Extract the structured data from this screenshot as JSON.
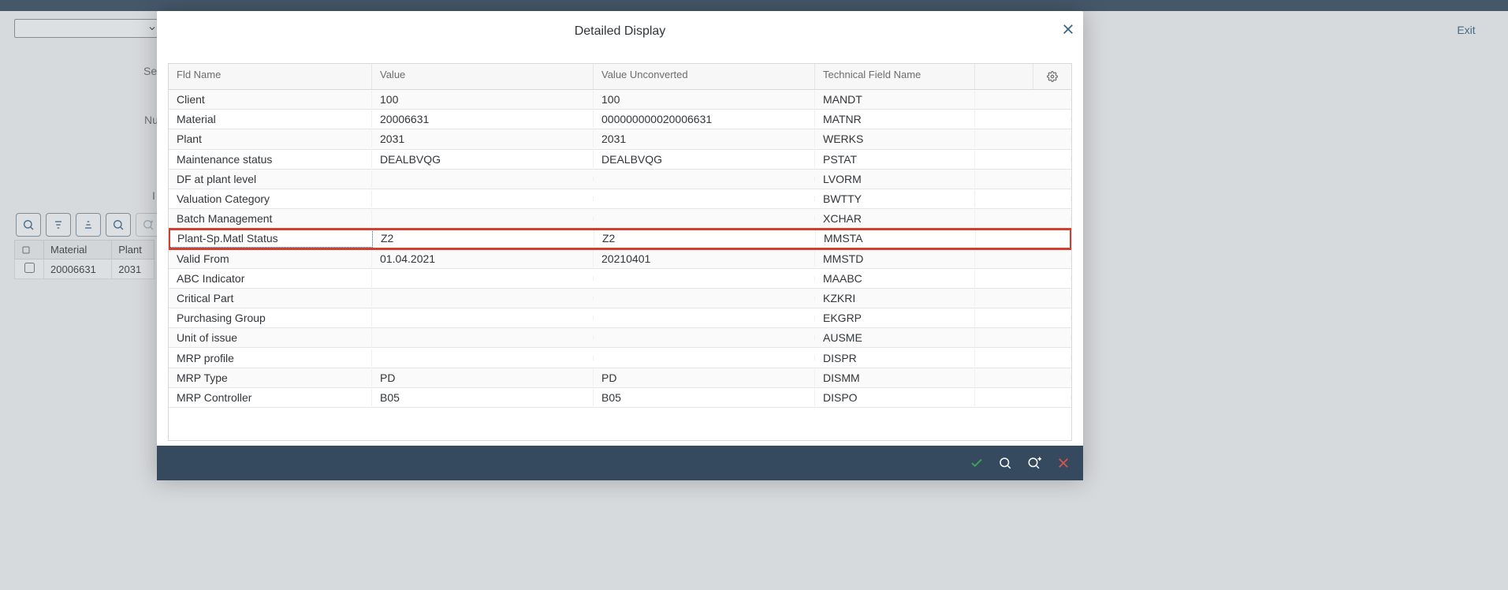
{
  "bg": {
    "exit_label": "Exit",
    "labels": {
      "se": "Se",
      "nu": "Nu",
      "i": "I"
    },
    "grid": {
      "columns": [
        "",
        "Material",
        "Plant"
      ],
      "row": {
        "material": "20006631",
        "plant": "2031"
      }
    }
  },
  "dialog": {
    "title": "Detailed Display",
    "columns": [
      "Fld Name",
      "Value",
      "Value Unconverted",
      "Technical Field Name"
    ],
    "rows": [
      {
        "fld": "Client",
        "val": "100",
        "uval": "100",
        "tech": "MANDT"
      },
      {
        "fld": "Material",
        "val": "20006631",
        "uval": "000000000020006631",
        "tech": "MATNR"
      },
      {
        "fld": "Plant",
        "val": "2031",
        "uval": "2031",
        "tech": "WERKS"
      },
      {
        "fld": "Maintenance status",
        "val": "DEALBVQG",
        "uval": "DEALBVQG",
        "tech": "PSTAT"
      },
      {
        "fld": "DF at plant level",
        "val": "",
        "uval": "",
        "tech": "LVORM"
      },
      {
        "fld": "Valuation Category",
        "val": "",
        "uval": "",
        "tech": "BWTTY"
      },
      {
        "fld": "Batch Management",
        "val": "",
        "uval": "",
        "tech": "XCHAR"
      },
      {
        "fld": "Plant-Sp.Matl Status",
        "val": "Z2",
        "uval": "Z2",
        "tech": "MMSTA",
        "highlight": true
      },
      {
        "fld": "Valid From",
        "val": "01.04.2021",
        "uval": "20210401",
        "tech": "MMSTD"
      },
      {
        "fld": "ABC Indicator",
        "val": "",
        "uval": "",
        "tech": "MAABC"
      },
      {
        "fld": "Critical Part",
        "val": "",
        "uval": "",
        "tech": "KZKRI"
      },
      {
        "fld": "Purchasing Group",
        "val": "",
        "uval": "",
        "tech": "EKGRP"
      },
      {
        "fld": "Unit of issue",
        "val": "",
        "uval": "",
        "tech": "AUSME"
      },
      {
        "fld": "MRP profile",
        "val": "",
        "uval": "",
        "tech": "DISPR"
      },
      {
        "fld": "MRP Type",
        "val": "PD",
        "uval": "PD",
        "tech": "DISMM"
      },
      {
        "fld": "MRP Controller",
        "val": "B05",
        "uval": "B05",
        "tech": "DISPO"
      }
    ]
  }
}
